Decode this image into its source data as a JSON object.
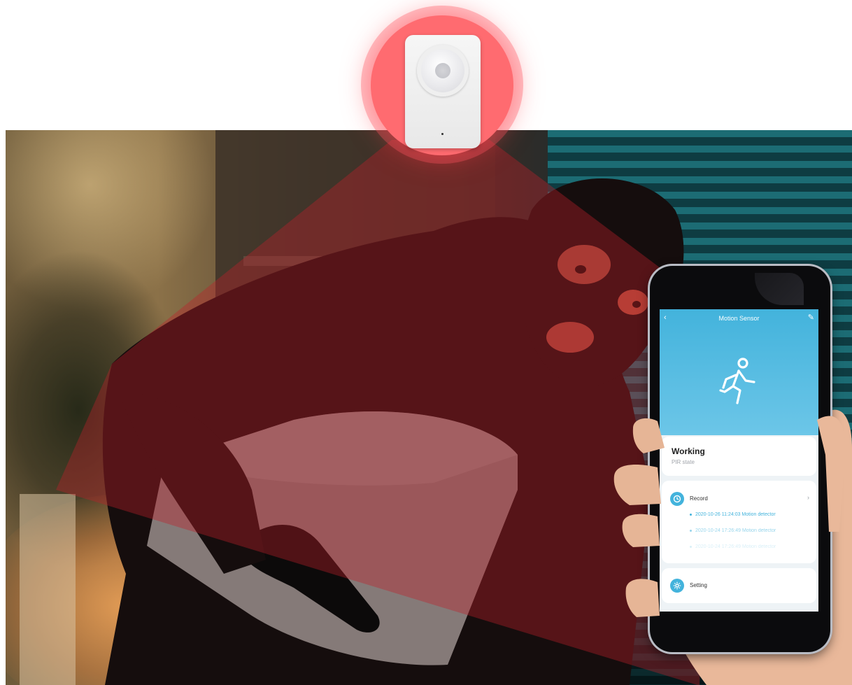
{
  "app": {
    "title": "Motion Sensor",
    "status": {
      "title": "Working",
      "subtitle": "PIR state"
    },
    "record": {
      "label": "Record",
      "items": [
        "2020-10-26 11:24:03 Motion detector",
        "2020-10-24 17:26:49 Motion detector",
        "2020-10-24 17:26:49 Motion detector"
      ]
    },
    "setting": {
      "label": "Setting"
    }
  },
  "colors": {
    "app_accent": "#43b3dc",
    "sensor_halo": "#ff6b70",
    "detection_red": "#c0202a"
  },
  "icons": [
    "back-icon",
    "edit-icon",
    "running-person-icon",
    "clock-icon",
    "gear-icon",
    "chevron-right-icon"
  ]
}
